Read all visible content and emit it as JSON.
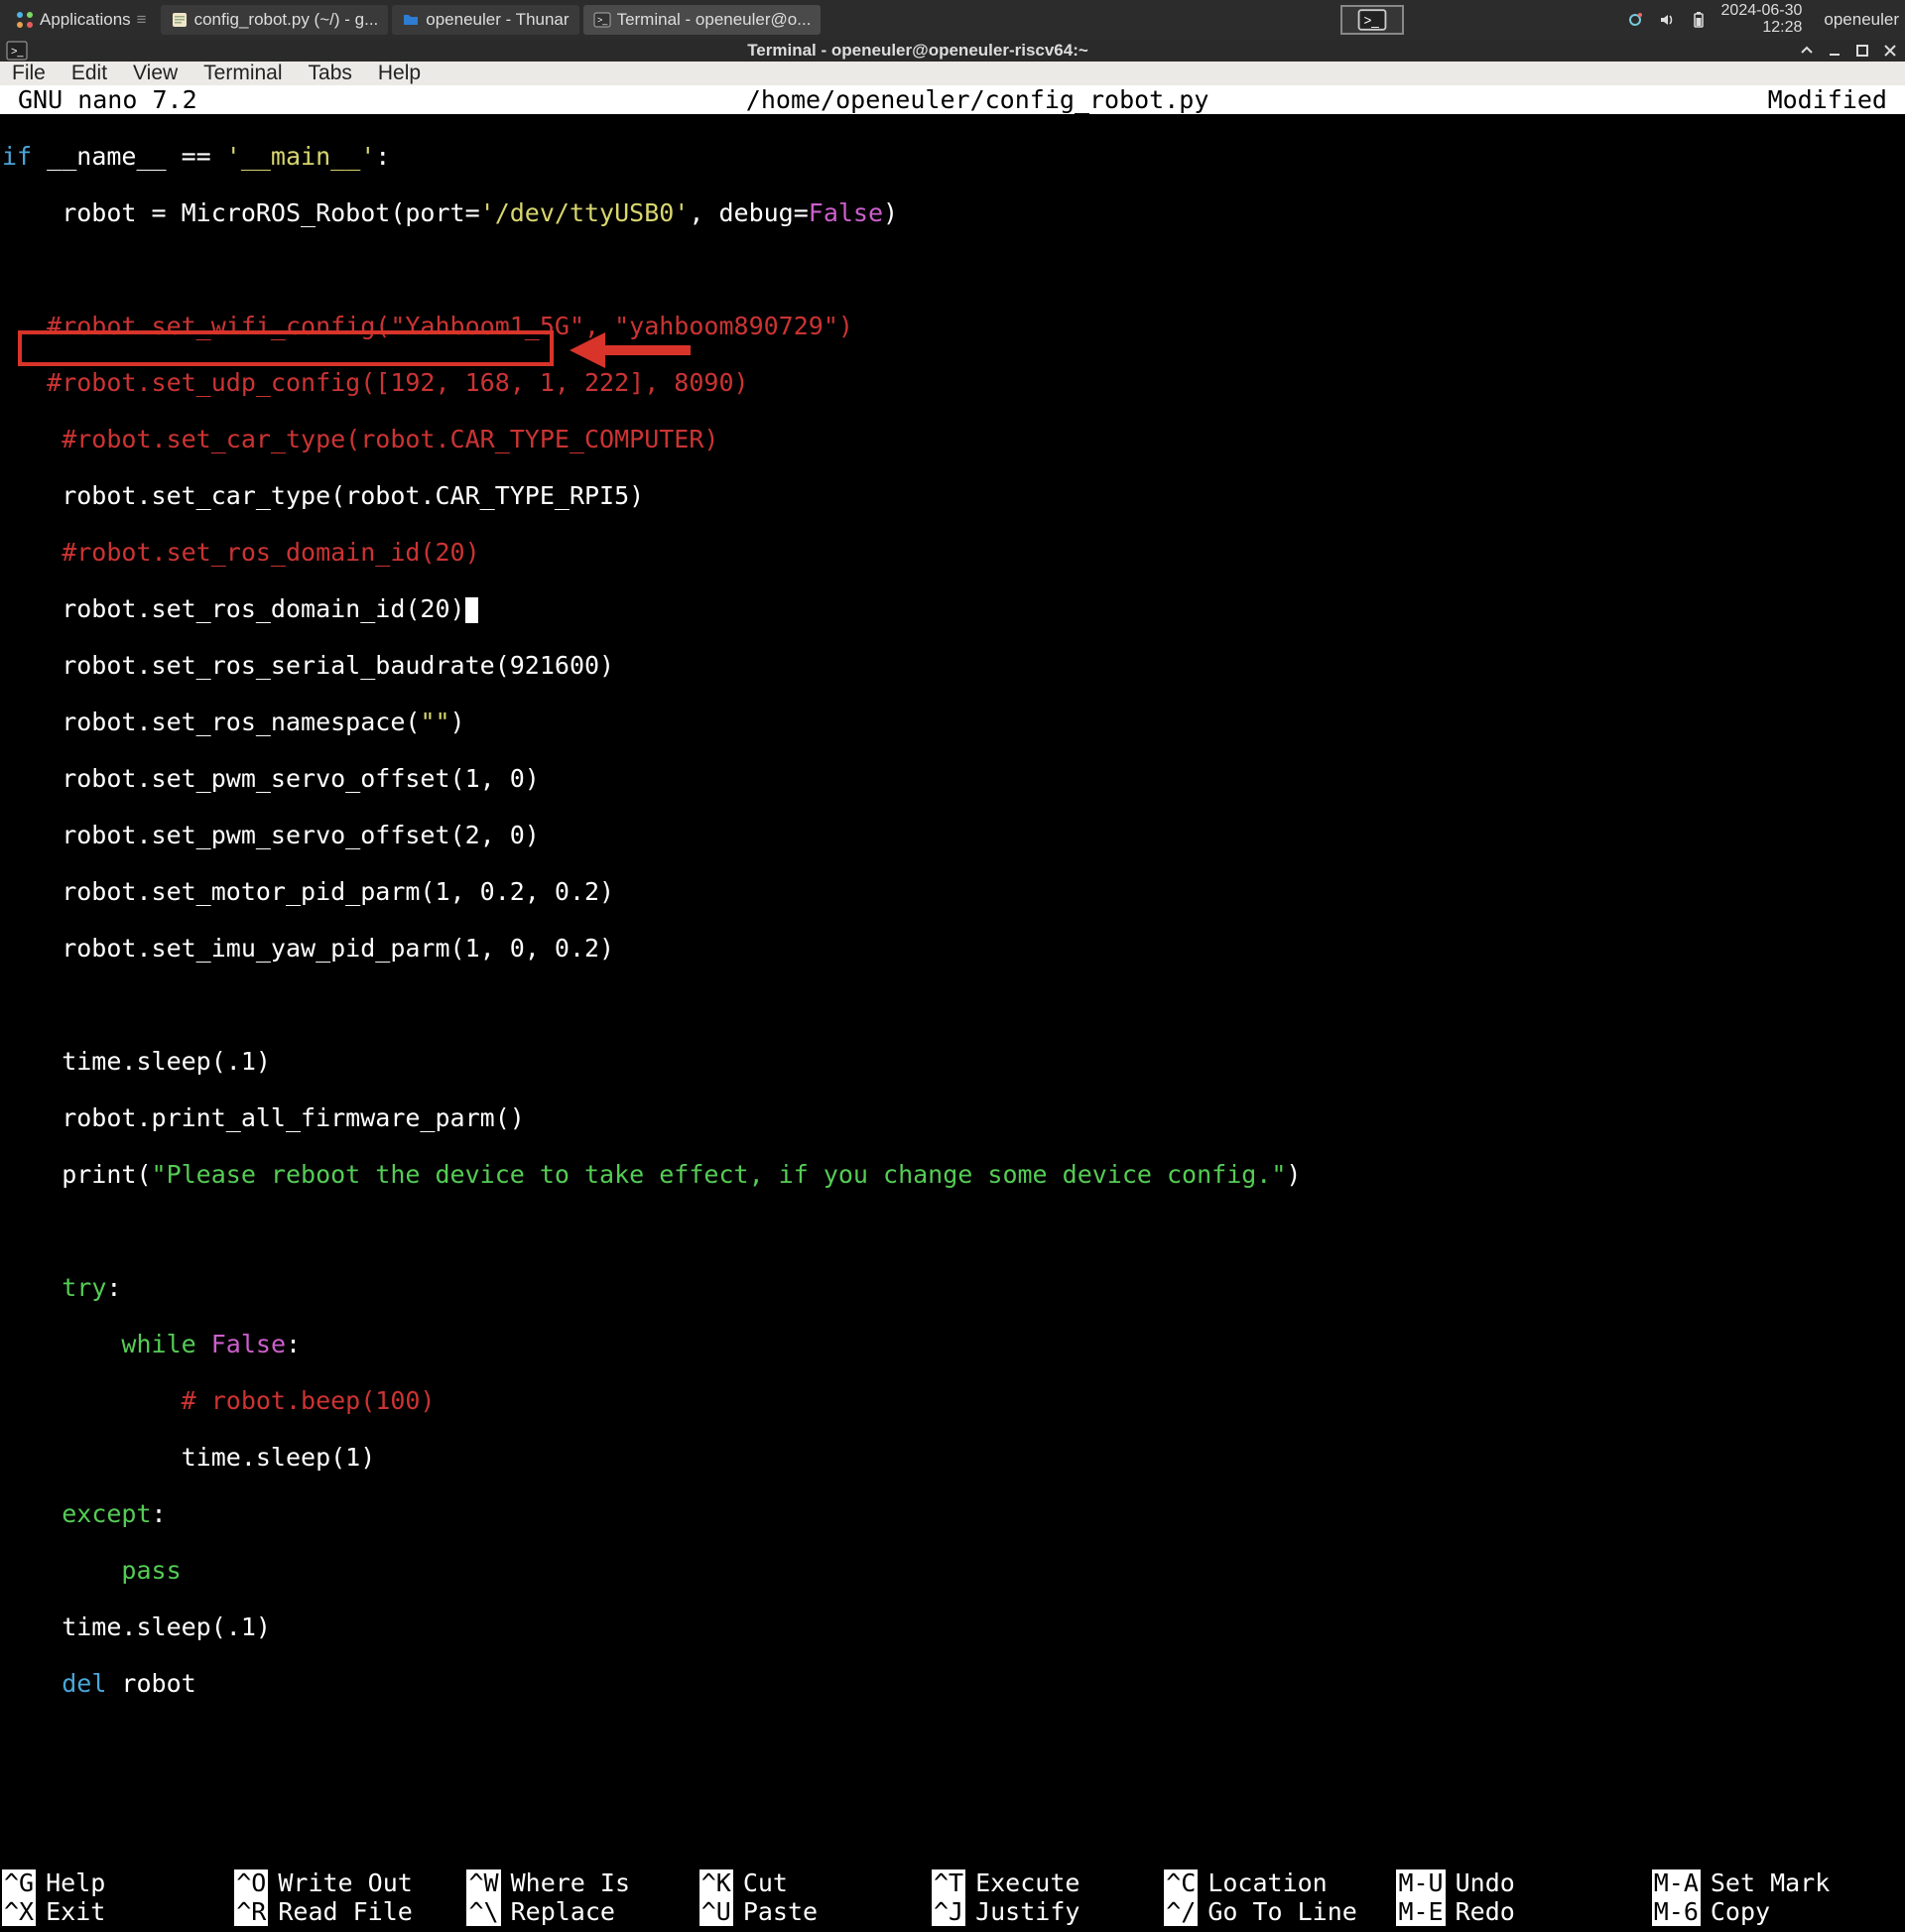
{
  "taskbar": {
    "app_menu": "Applications",
    "items": [
      {
        "label": "config_robot.py (~/) - g..."
      },
      {
        "label": "openeuler - Thunar"
      },
      {
        "label": "Terminal - openeuler@o..."
      }
    ],
    "date": "2024-06-30",
    "time": "12:28",
    "user": "openeuler"
  },
  "window": {
    "title": "Terminal - openeuler@openeuler-riscv64:~"
  },
  "menus": [
    "File",
    "Edit",
    "View",
    "Terminal",
    "Tabs",
    "Help"
  ],
  "nano": {
    "app": "  GNU nano 7.2",
    "path": "/home/openeuler/config_robot.py",
    "status": "Modified"
  },
  "code": {
    "l0_if": "if",
    "l0_name": " __name__ == ",
    "l0_main": "'__main__'",
    "l0_colon": ":",
    "l1a": "    robot = MicroROS_Robot(port=",
    "l1b": "'/dev/ttyUSB0'",
    "l1c": ", debug=",
    "l1d": "False",
    "l1e": ")",
    "l3": "   #robot.set_wifi_config(\"Yahboom1_5G\", \"yahboom890729\")",
    "l4": "   #robot.set_udp_config([192, 168, 1, 222], 8090)",
    "l5": "    #robot.set_car_type(robot.CAR_TYPE_COMPUTER)",
    "l6": "    robot.set_car_type(robot.CAR_TYPE_RPI5)",
    "l7": "    #robot.set_ros_domain_id(20)",
    "l8": "    robot.set_ros_domain_id(20)",
    "l9": "    robot.set_ros_serial_baudrate(921600)",
    "l10a": "    robot.set_ros_namespace(",
    "l10b": "\"\"",
    "l10c": ")",
    "l11": "    robot.set_pwm_servo_offset(1, 0)",
    "l12": "    robot.set_pwm_servo_offset(2, 0)",
    "l13": "    robot.set_motor_pid_parm(1, 0.2, 0.2)",
    "l14": "    robot.set_imu_yaw_pid_parm(1, 0, 0.2)",
    "l16": "    time.sleep(.1)",
    "l17": "    robot.print_all_firmware_parm()",
    "l18a": "    print(",
    "l18b": "\"Please reboot the device to take effect, if you change some device config.\"",
    "l18c": ")",
    "l20a": "    ",
    "l20b": "try",
    "l20c": ":",
    "l21a": "        ",
    "l21b": "while",
    "l21c": " ",
    "l21d": "False",
    "l21e": ":",
    "l22": "            # robot.beep(100)",
    "l23": "            time.sleep(1)",
    "l24a": "    ",
    "l24b": "except",
    "l24c": ":",
    "l25a": "        ",
    "l25b": "pass",
    "l26": "    time.sleep(.1)",
    "l27a": "    ",
    "l27b": "del",
    "l27c": " robot"
  },
  "shortcuts": [
    [
      [
        "^G",
        "Help"
      ],
      [
        "^X",
        "Exit"
      ]
    ],
    [
      [
        "^O",
        "Write Out"
      ],
      [
        "^R",
        "Read File"
      ]
    ],
    [
      [
        "^W",
        "Where Is"
      ],
      [
        "^\\",
        "Replace"
      ]
    ],
    [
      [
        "^K",
        "Cut"
      ],
      [
        "^U",
        "Paste"
      ]
    ],
    [
      [
        "^T",
        "Execute"
      ],
      [
        "^J",
        "Justify"
      ]
    ],
    [
      [
        "^C",
        "Location"
      ],
      [
        "^/",
        "Go To Line"
      ]
    ],
    [
      [
        "M-U",
        "Undo"
      ],
      [
        "M-E",
        "Redo"
      ]
    ],
    [
      [
        "M-A",
        "Set Mark"
      ],
      [
        "M-6",
        "Copy"
      ]
    ]
  ]
}
